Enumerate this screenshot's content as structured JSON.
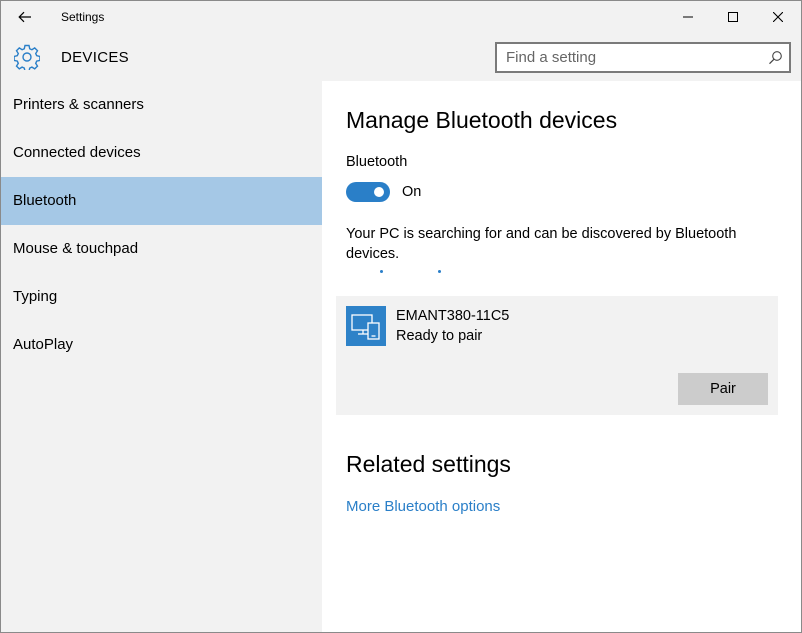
{
  "window": {
    "title": "Settings",
    "controls": {
      "minimize": "minimize-icon",
      "maximize": "maximize-icon",
      "close": "close-icon"
    }
  },
  "header": {
    "section": "DEVICES",
    "search_placeholder": "Find a setting"
  },
  "sidebar": {
    "items": [
      {
        "label": "Printers & scanners",
        "selected": false
      },
      {
        "label": "Connected devices",
        "selected": false
      },
      {
        "label": "Bluetooth",
        "selected": true
      },
      {
        "label": "Mouse & touchpad",
        "selected": false
      },
      {
        "label": "Typing",
        "selected": false
      },
      {
        "label": "AutoPlay",
        "selected": false
      }
    ]
  },
  "main": {
    "title": "Manage Bluetooth devices",
    "bluetooth_label": "Bluetooth",
    "toggle_state": "On",
    "toggle_on": true,
    "search_message": "Your PC is searching for and can be discovered by Bluetooth devices.",
    "device": {
      "name": "EMANT380-11C5",
      "status": "Ready to pair",
      "pair_label": "Pair",
      "icon": "devices-icon"
    },
    "related_title": "Related settings",
    "link": "More Bluetooth options"
  },
  "colors": {
    "accent": "#2a7fc8",
    "selected": "#a5c8e6",
    "chrome": "#f2f2f2",
    "button": "#cccccc"
  }
}
